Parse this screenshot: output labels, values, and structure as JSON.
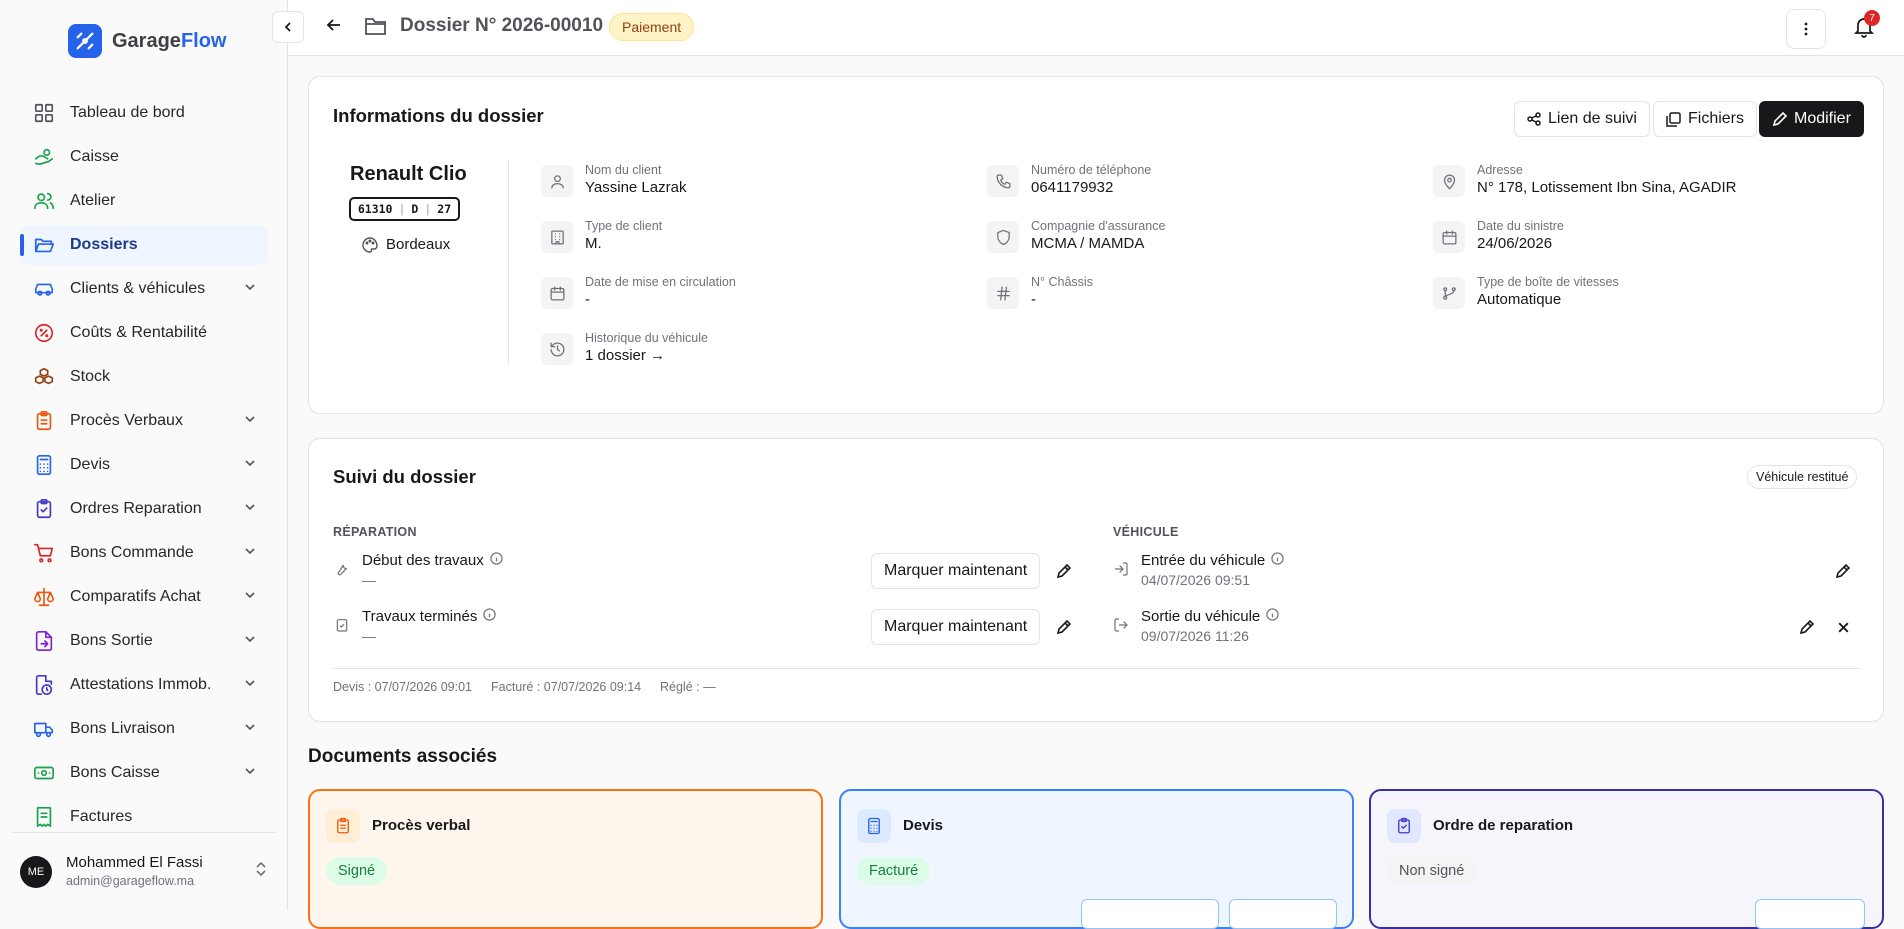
{
  "app": {
    "name_part1": "Garage",
    "name_part2": "Flow",
    "brand_color": "#2563eb"
  },
  "sidebar": {
    "items": [
      {
        "label": "Tableau de bord",
        "icon": "dashboard-icon",
        "chevron": false,
        "active": false,
        "color": "#52525b"
      },
      {
        "label": "Caisse",
        "icon": "cash-hand-icon",
        "chevron": false,
        "active": false,
        "color": "#16a34a"
      },
      {
        "label": "Atelier",
        "icon": "users-icon",
        "chevron": false,
        "active": false,
        "color": "#16a34a"
      },
      {
        "label": "Dossiers",
        "icon": "folder-open-icon",
        "chevron": false,
        "active": true,
        "color": "#2563eb"
      },
      {
        "label": "Clients & véhicules",
        "icon": "car-icon",
        "chevron": true,
        "active": false,
        "color": "#2563eb"
      },
      {
        "label": "Coûts & Rentabilité",
        "icon": "percent-icon",
        "chevron": false,
        "active": false,
        "color": "#dc2626"
      },
      {
        "label": "Stock",
        "icon": "boxes-icon",
        "chevron": false,
        "active": false,
        "color": "#92400e"
      },
      {
        "label": "Procès Verbaux",
        "icon": "clipboard-icon",
        "chevron": true,
        "active": false,
        "color": "#ea580c"
      },
      {
        "label": "Devis",
        "icon": "calculator-icon",
        "chevron": true,
        "active": false,
        "color": "#2563eb"
      },
      {
        "label": "Ordres Reparation",
        "icon": "clipboard-check-icon",
        "chevron": true,
        "active": false,
        "color": "#4338ca"
      },
      {
        "label": "Bons Commande",
        "icon": "cart-icon",
        "chevron": true,
        "active": false,
        "color": "#dc2626"
      },
      {
        "label": "Comparatifs Achat",
        "icon": "scale-icon",
        "chevron": true,
        "active": false,
        "color": "#ea580c"
      },
      {
        "label": "Bons Sortie",
        "icon": "file-export-icon",
        "chevron": true,
        "active": false,
        "color": "#7e22ce"
      },
      {
        "label": "Attestations Immob.",
        "icon": "file-clock-icon",
        "chevron": true,
        "active": false,
        "color": "#4338ca"
      },
      {
        "label": "Bons Livraison",
        "icon": "truck-icon",
        "chevron": true,
        "active": false,
        "color": "#2563eb"
      },
      {
        "label": "Bons Caisse",
        "icon": "banknote-icon",
        "chevron": true,
        "active": false,
        "color": "#16a34a"
      },
      {
        "label": "Factures",
        "icon": "receipt-icon",
        "chevron": false,
        "active": false,
        "color": "#16a34a"
      }
    ]
  },
  "user": {
    "initials": "ME",
    "name": "Mohammed El Fassi",
    "email": "admin@garageflow.ma"
  },
  "header": {
    "title": "Dossier N° 2026-00010",
    "status": "Paiement",
    "notifications": "7"
  },
  "info": {
    "title": "Informations du dossier",
    "actions": {
      "tracking": "Lien de suivi",
      "files": "Fichiers",
      "edit": "Modifier"
    },
    "vehicle": {
      "model": "Renault Clio",
      "plate": [
        "61310",
        "D",
        "27"
      ],
      "color": "Bordeaux"
    },
    "fields": [
      {
        "label": "Nom du client",
        "value": "Yassine Lazrak",
        "icon": "user-icon"
      },
      {
        "label": "Numéro de téléphone",
        "value": "0641179932",
        "icon": "phone-icon"
      },
      {
        "label": "Adresse",
        "value": "N° 178, Lotissement Ibn Sina, AGADIR",
        "icon": "map-pin-icon"
      },
      {
        "label": "Type de client",
        "value": "M.",
        "icon": "building-icon"
      },
      {
        "label": "Compagnie d'assurance",
        "value": "MCMA / MAMDA",
        "icon": "shield-icon"
      },
      {
        "label": "Date du sinistre",
        "value": "24/06/2026",
        "icon": "calendar-icon"
      },
      {
        "label": "Date de mise en circulation",
        "value": "-",
        "icon": "calendar-icon"
      },
      {
        "label": "N° Châssis",
        "value": "-",
        "icon": "hash-icon"
      },
      {
        "label": "Type de boîte de vitesses",
        "value": "Automatique",
        "icon": "gearbox-icon"
      },
      {
        "label": "Historique du véhicule",
        "value": "1 dossier →",
        "icon": "history-icon"
      }
    ]
  },
  "tracking": {
    "title": "Suivi du dossier",
    "badge": "Véhicule restitué",
    "repair_label": "RÉPARATION",
    "vehicle_label": "VÉHICULE",
    "mark_now": "Marquer maintenant",
    "repair_steps": [
      {
        "name": "Début des travaux",
        "value": "—"
      },
      {
        "name": "Travaux terminés",
        "value": "—"
      }
    ],
    "vehicle_steps": [
      {
        "name": "Entrée du véhicule",
        "value": "04/07/2026 09:51"
      },
      {
        "name": "Sortie du véhicule",
        "value": "09/07/2026 11:26"
      }
    ],
    "footer": {
      "devis": "Devis : 07/07/2026 09:01",
      "facture": "Facturé : 07/07/2026 09:14",
      "regle": "Réglé : —"
    }
  },
  "documents": {
    "title": "Documents associés",
    "cards": [
      {
        "name": "Procès verbal",
        "status": "Signé",
        "border": "#f97316",
        "bg": "#fff7ed",
        "icon_bg": "#ffedd5",
        "icon_color": "#ea580c",
        "status_bg": "#dcfce7",
        "status_color": "#15803d"
      },
      {
        "name": "Devis",
        "status": "Facturé",
        "border": "#3b82f6",
        "bg": "#eff6ff",
        "icon_bg": "#dbeafe",
        "icon_color": "#2563eb",
        "status_bg": "#dcfce7",
        "status_color": "#15803d"
      },
      {
        "name": "Ordre de reparation",
        "status": "Non signé",
        "border": "#3730a3",
        "bg": "#f5f5fb",
        "icon_bg": "#e0e7ff",
        "icon_color": "#4338ca",
        "status_bg": "#f4f4f5",
        "status_color": "#52525b"
      }
    ]
  }
}
